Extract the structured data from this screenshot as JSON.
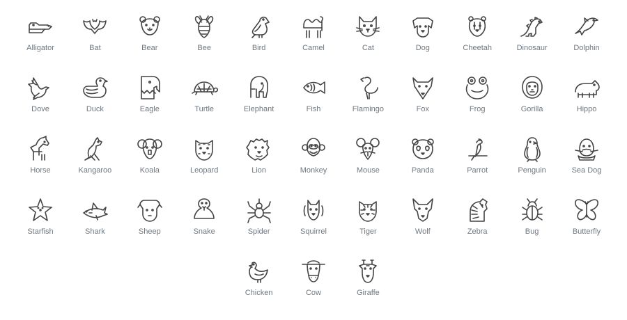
{
  "icon_stroke_color": "#444444",
  "label_color": "#6f7880",
  "rows": [
    [
      {
        "label": "Alligator",
        "icon": "alligator-icon"
      },
      {
        "label": "Bat",
        "icon": "bat-icon"
      },
      {
        "label": "Bear",
        "icon": "bear-icon"
      },
      {
        "label": "Bee",
        "icon": "bee-icon"
      },
      {
        "label": "Bird",
        "icon": "bird-icon"
      },
      {
        "label": "Camel",
        "icon": "camel-icon"
      },
      {
        "label": "Cat",
        "icon": "cat-icon"
      },
      {
        "label": "Dog",
        "icon": "dog-icon"
      },
      {
        "label": "Cheetah",
        "icon": "cheetah-icon"
      },
      {
        "label": "Dinosaur",
        "icon": "dinosaur-icon"
      },
      {
        "label": "Dolphin",
        "icon": "dolphin-icon"
      }
    ],
    [
      {
        "label": "Dove",
        "icon": "dove-icon"
      },
      {
        "label": "Duck",
        "icon": "duck-icon"
      },
      {
        "label": "Eagle",
        "icon": "eagle-icon"
      },
      {
        "label": "Turtle",
        "icon": "turtle-icon"
      },
      {
        "label": "Elephant",
        "icon": "elephant-icon"
      },
      {
        "label": "Fish",
        "icon": "fish-icon"
      },
      {
        "label": "Flamingo",
        "icon": "flamingo-icon"
      },
      {
        "label": "Fox",
        "icon": "fox-icon"
      },
      {
        "label": "Frog",
        "icon": "frog-icon"
      },
      {
        "label": "Gorilla",
        "icon": "gorilla-icon"
      },
      {
        "label": "Hippo",
        "icon": "hippo-icon"
      }
    ],
    [
      {
        "label": "Horse",
        "icon": "horse-icon"
      },
      {
        "label": "Kangaroo",
        "icon": "kangaroo-icon"
      },
      {
        "label": "Koala",
        "icon": "koala-icon"
      },
      {
        "label": "Leopard",
        "icon": "leopard-icon"
      },
      {
        "label": "Lion",
        "icon": "lion-icon"
      },
      {
        "label": "Monkey",
        "icon": "monkey-icon"
      },
      {
        "label": "Mouse",
        "icon": "mouse-icon"
      },
      {
        "label": "Panda",
        "icon": "panda-icon"
      },
      {
        "label": "Parrot",
        "icon": "parrot-icon"
      },
      {
        "label": "Penguin",
        "icon": "penguin-icon"
      },
      {
        "label": "Sea Dog",
        "icon": "sea-dog-icon"
      }
    ],
    [
      {
        "label": "Starfish",
        "icon": "starfish-icon"
      },
      {
        "label": "Shark",
        "icon": "shark-icon"
      },
      {
        "label": "Sheep",
        "icon": "sheep-icon"
      },
      {
        "label": "Snake",
        "icon": "snake-icon"
      },
      {
        "label": "Spider",
        "icon": "spider-icon"
      },
      {
        "label": "Squirrel",
        "icon": "squirrel-icon"
      },
      {
        "label": "Tiger",
        "icon": "tiger-icon"
      },
      {
        "label": "Wolf",
        "icon": "wolf-icon"
      },
      {
        "label": "Zebra",
        "icon": "zebra-icon"
      },
      {
        "label": "Bug",
        "icon": "bug-icon"
      },
      {
        "label": "Butterfly",
        "icon": "butterfly-icon"
      }
    ],
    [
      {
        "label": "Chicken",
        "icon": "chicken-icon"
      },
      {
        "label": "Cow",
        "icon": "cow-icon"
      },
      {
        "label": "Giraffe",
        "icon": "giraffe-icon"
      }
    ]
  ]
}
